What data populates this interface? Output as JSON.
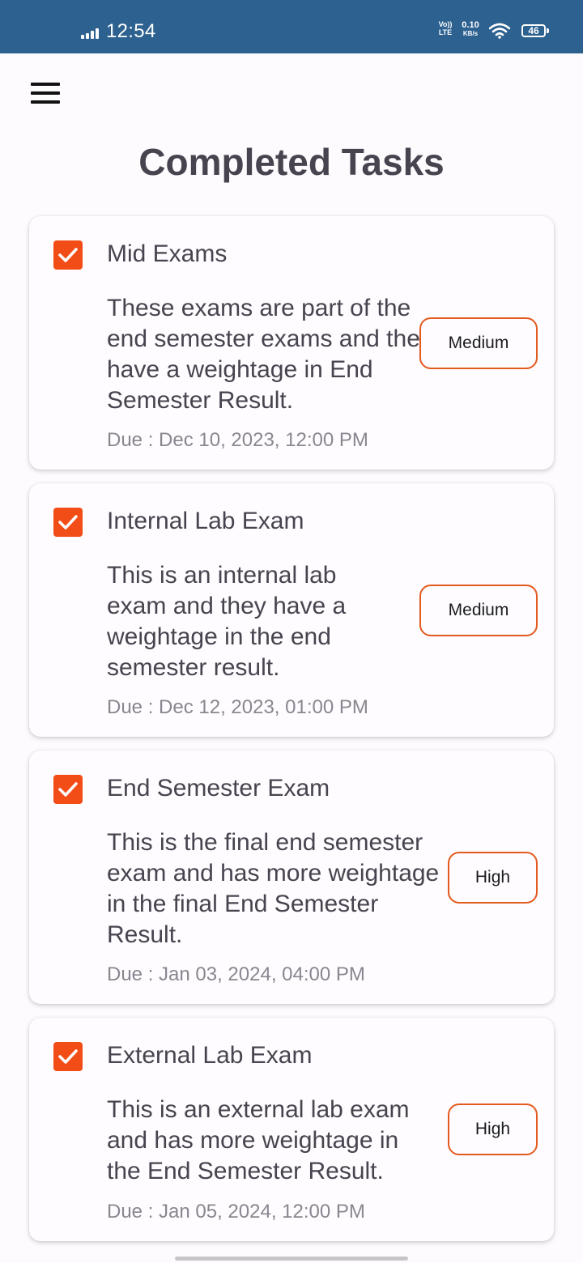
{
  "status_bar": {
    "time": "12:54",
    "volte_top": "Vo))",
    "volte_bottom": "LTE",
    "net_speed_value": "0.10",
    "net_speed_unit": "KB/s",
    "battery": "46"
  },
  "header": {
    "menu_icon": "hamburger-menu-icon",
    "title": "Completed Tasks"
  },
  "colors": {
    "status_bar": "#2c6190",
    "accent": "#f24d16",
    "chip_border": "#e35a1e",
    "text_primary": "#47444f",
    "text_secondary": "#898690"
  },
  "tasks": [
    {
      "checked": true,
      "title": "Mid Exams",
      "description": "These exams are part of the end semester exams and they have a weightage in End Semester Result.",
      "due": "Due : Dec 10, 2023, 12:00 PM",
      "priority": "Medium"
    },
    {
      "checked": true,
      "title": "Internal Lab Exam",
      "description": "This is an internal lab exam and they have a weightage in the end semester result.",
      "due": "Due : Dec 12, 2023, 01:00 PM",
      "priority": "Medium"
    },
    {
      "checked": true,
      "title": "End Semester Exam",
      "description": "This is the final end semester exam and has more weightage in the final End Semester Result.",
      "due": "Due : Jan 03, 2024, 04:00 PM",
      "priority": "High"
    },
    {
      "checked": true,
      "title": "External Lab Exam",
      "description": "This is an external lab exam and has more weightage in the End Semester Result.",
      "due": "Due : Jan 05, 2024, 12:00 PM",
      "priority": "High"
    }
  ]
}
